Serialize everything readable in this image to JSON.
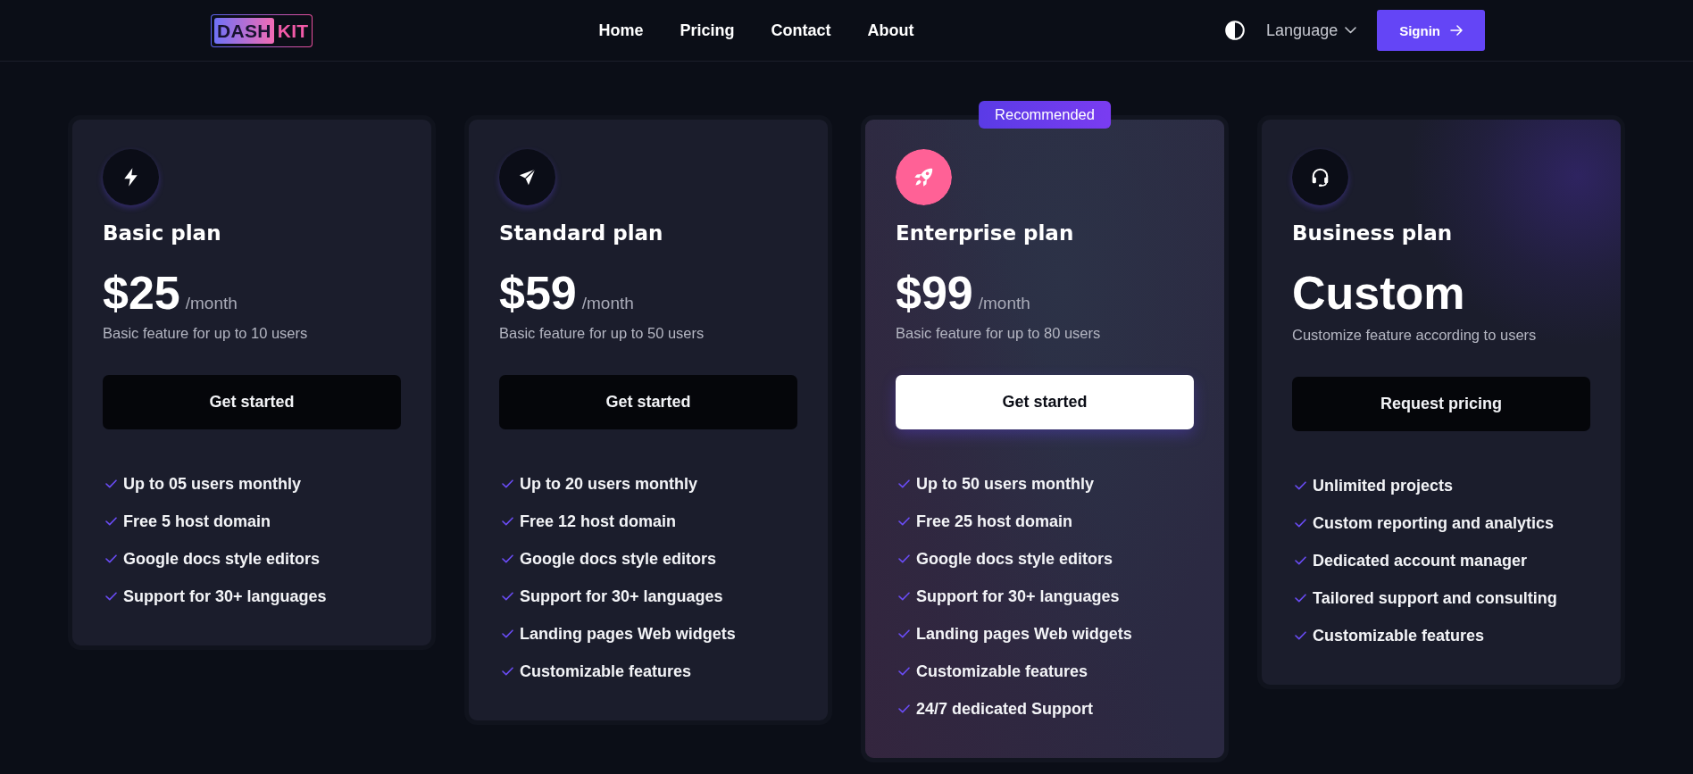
{
  "header": {
    "logo": {
      "badge": "DASH",
      "text": "KIT"
    },
    "nav": [
      {
        "label": "Home"
      },
      {
        "label": "Pricing"
      },
      {
        "label": "Contact"
      },
      {
        "label": "About"
      }
    ],
    "language": "Language",
    "signin": "Signin"
  },
  "plans": [
    {
      "featured": false,
      "title": "Basic plan",
      "price": "$25",
      "period": "/month",
      "description": "Basic feature for up to 10 users",
      "button": "Get started",
      "features": [
        "Up to 05 users monthly",
        "Free 5 host domain",
        "Google docs style editors",
        "Support for 30+ languages"
      ]
    },
    {
      "featured": false,
      "title": "Standard plan",
      "price": "$59",
      "period": "/month",
      "description": "Basic feature for up to 50 users",
      "button": "Get started",
      "features": [
        "Up to 20 users monthly",
        "Free 12 host domain",
        "Google docs style editors",
        "Support for 30+ languages",
        "Landing pages Web widgets",
        "Customizable features"
      ]
    },
    {
      "featured": true,
      "badge": "Recommended",
      "title": "Enterprise plan",
      "price": "$99",
      "period": "/month",
      "description": "Basic feature for up to 80 users",
      "button": "Get started",
      "features": [
        "Up to 50 users monthly",
        "Free 25 host domain",
        "Google docs style editors",
        "Support for 30+ languages",
        "Landing pages Web widgets",
        "Customizable features",
        "24/7 dedicated Support"
      ]
    },
    {
      "featured": false,
      "title": "Business plan",
      "price": "Custom",
      "description": "Customize feature according to users",
      "button": "Request pricing",
      "features": [
        "Unlimited projects",
        "Custom reporting and analytics",
        "Dedicated account manager",
        "Tailored support and consulting",
        "Customizable features"
      ]
    }
  ]
}
